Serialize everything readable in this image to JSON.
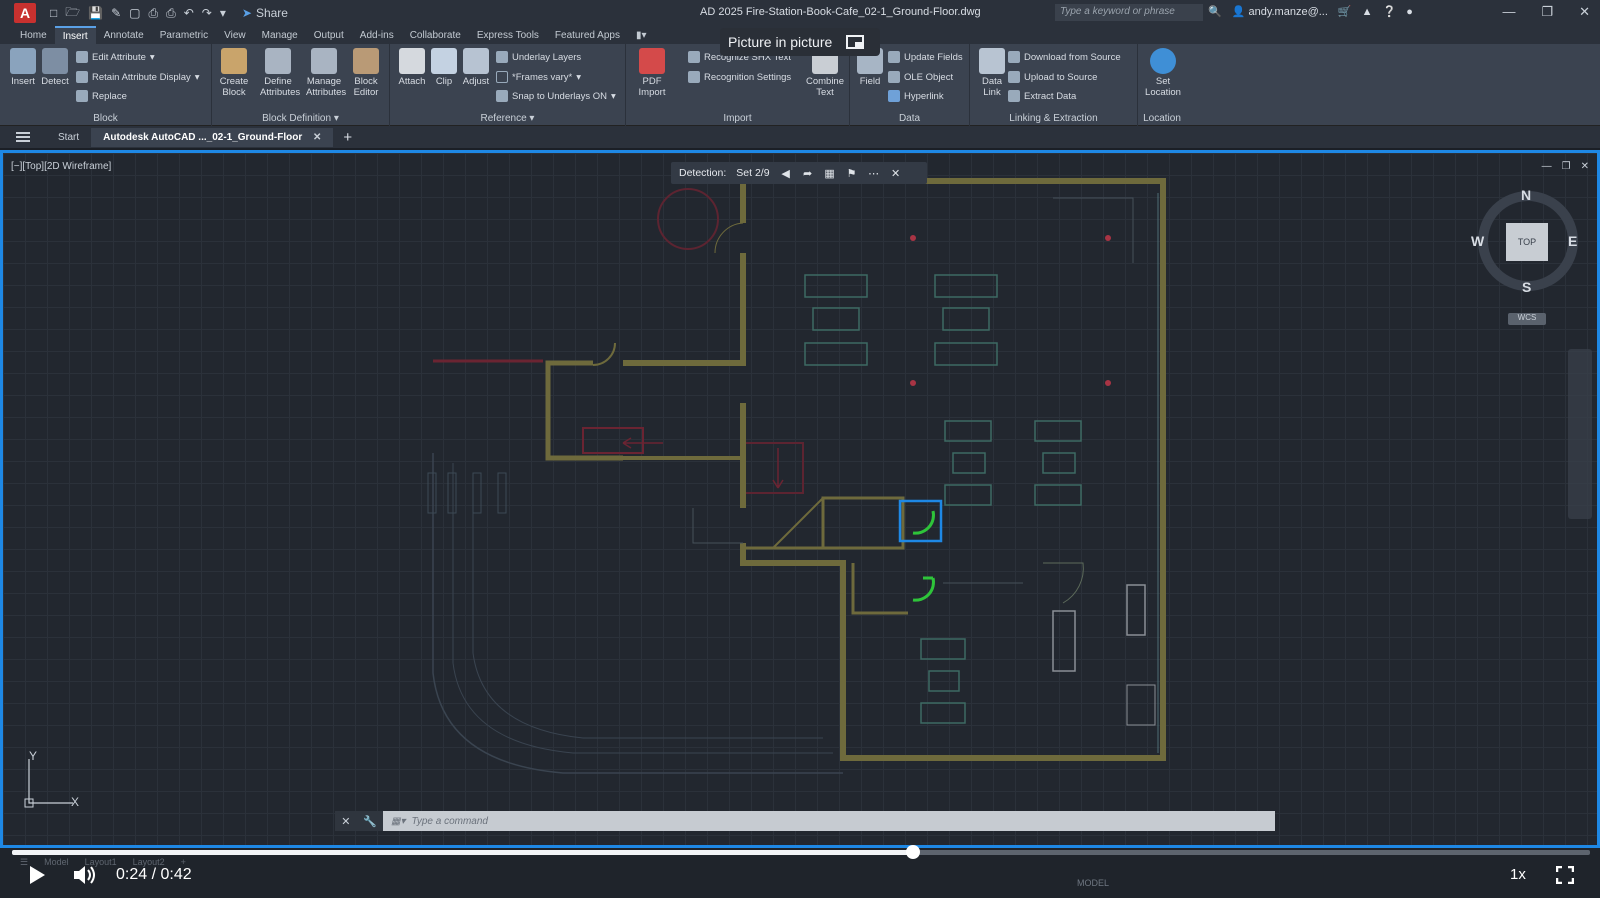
{
  "titlebar": {
    "logo": "A",
    "share_label": "Share",
    "doc_title": "AD 2025  Fire-Station-Book-Cafe_02-1_Ground-Floor.dwg",
    "search_placeholder": "Type a keyword or phrase",
    "user": "andy.manze@..."
  },
  "ribbon_tabs": [
    "Home",
    "Insert",
    "Annotate",
    "Parametric",
    "View",
    "Manage",
    "Output",
    "Add-ins",
    "Collaborate",
    "Express Tools",
    "Featured Apps"
  ],
  "active_tab": "Insert",
  "ribbon": {
    "block": {
      "title": "Block",
      "insert": "Insert",
      "detect": "Detect",
      "edit_attribute": "Edit Attribute",
      "retain_attribute_display": "Retain Attribute Display",
      "replace": "Replace"
    },
    "block_definition": {
      "title": "Block Definition",
      "create_block": "Create Block",
      "define_attributes": "Define Attributes",
      "manage_attributes": "Manage Attributes",
      "block_editor": "Block Editor"
    },
    "reference": {
      "title": "Reference",
      "attach": "Attach",
      "clip": "Clip",
      "adjust": "Adjust",
      "underlay_layers": "Underlay Layers",
      "frames_vary": "*Frames vary*",
      "snap_to_underlays": "Snap to Underlays ON"
    },
    "import": {
      "title": "Import",
      "pdf_import": "PDF Import",
      "recognize_shx": "Recognize SHX Text",
      "recognition_settings": "Recognition Settings",
      "combine_text": "Combine Text"
    },
    "data": {
      "title": "Data",
      "field": "Field",
      "update_fields": "Update Fields",
      "ole_object": "OLE Object",
      "hyperlink": "Hyperlink"
    },
    "linking": {
      "title": "Linking & Extraction",
      "data_link": "Data Link",
      "download_from_source": "Download from Source",
      "upload_to_source": "Upload to Source",
      "extract_data": "Extract  Data"
    },
    "location": {
      "title": "Location",
      "set_location": "Set Location"
    }
  },
  "pip": {
    "label": "Picture in picture"
  },
  "file_tabs": {
    "start": "Start",
    "active": "Autodesk AutoCAD ..._02-1_Ground-Floor"
  },
  "viewport": {
    "label": "[−][Top][2D Wireframe]",
    "detection_label": "Detection:",
    "set_label": "Set  2/9",
    "compass": {
      "n": "N",
      "s": "S",
      "e": "E",
      "w": "W",
      "cube": "TOP",
      "wcs": "WCS"
    },
    "ucs_y": "Y",
    "ucs_x": "X"
  },
  "command": {
    "placeholder": "Type  a  command"
  },
  "status": {
    "model": "MODEL",
    "layout_tabs": [
      "Model",
      "Layout1",
      "Layout2"
    ]
  },
  "video": {
    "current_time": "0:24",
    "separator": "/",
    "duration": "0:42",
    "progress": 0.571,
    "speed": "1x"
  },
  "colors": {
    "accent_blue": "#1e88e5",
    "wall": "#6e6a3c",
    "highlight": "#2ec43a",
    "red": "#8a2a35"
  }
}
